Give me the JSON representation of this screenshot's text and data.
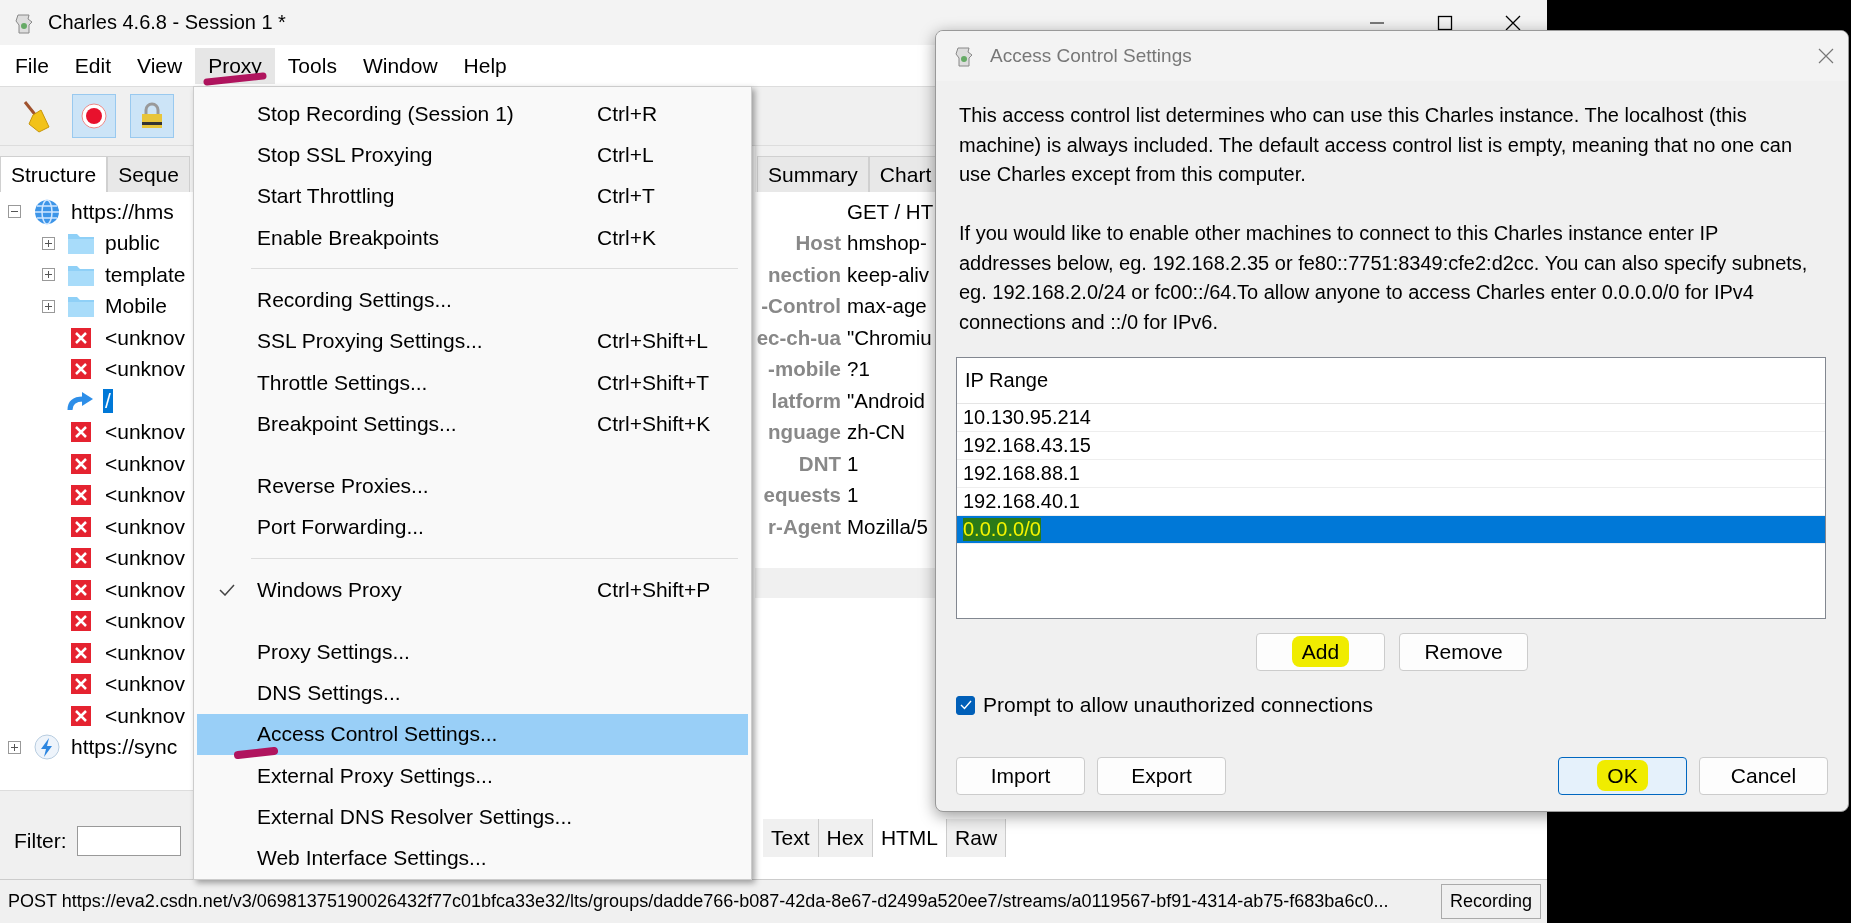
{
  "window": {
    "title": "Charles 4.6.8 - Session 1 *"
  },
  "menu_bar": [
    {
      "label": "File",
      "selected": false,
      "marked": false
    },
    {
      "label": "Edit",
      "selected": false,
      "marked": false
    },
    {
      "label": "View",
      "selected": false,
      "marked": false
    },
    {
      "label": "Proxy",
      "selected": true,
      "marked": true
    },
    {
      "label": "Tools",
      "selected": false,
      "marked": false
    },
    {
      "label": "Window",
      "selected": false,
      "marked": false
    },
    {
      "label": "Help",
      "selected": false,
      "marked": false
    }
  ],
  "left_tabs": [
    {
      "label": "Structure",
      "selected": true
    },
    {
      "label": "Seque",
      "selected": false
    }
  ],
  "tree": [
    {
      "label": "https://hms",
      "kind": "host",
      "expanded": true,
      "selected": false,
      "children": [
        {
          "label": "public",
          "kind": "folder",
          "expanded": false,
          "selected": false
        },
        {
          "label": "template",
          "kind": "folder",
          "expanded": false,
          "selected": false
        },
        {
          "label": "Mobile",
          "kind": "folder",
          "expanded": false,
          "selected": false
        },
        {
          "label": "<unknov",
          "kind": "error",
          "selected": false
        },
        {
          "label": "<unknov",
          "kind": "error",
          "selected": false
        },
        {
          "label": "/",
          "kind": "redirect",
          "selected": true
        },
        {
          "label": "<unknov",
          "kind": "error",
          "selected": false
        },
        {
          "label": "<unknov",
          "kind": "error",
          "selected": false
        },
        {
          "label": "<unknov",
          "kind": "error",
          "selected": false
        },
        {
          "label": "<unknov",
          "kind": "error",
          "selected": false
        },
        {
          "label": "<unknov",
          "kind": "error",
          "selected": false
        },
        {
          "label": "<unknov",
          "kind": "error",
          "selected": false
        },
        {
          "label": "<unknov",
          "kind": "error",
          "selected": false
        },
        {
          "label": "<unknov",
          "kind": "error",
          "selected": false
        },
        {
          "label": "<unknov",
          "kind": "error",
          "selected": false
        },
        {
          "label": "<unknov",
          "kind": "error",
          "selected": false
        }
      ]
    },
    {
      "label": "https://sync",
      "kind": "host-bolt",
      "expanded": false,
      "selected": false
    }
  ],
  "filter": {
    "label": "Filter:"
  },
  "detail_tabs": [
    {
      "label": "Summary",
      "selected": false
    },
    {
      "label": "Chart",
      "selected": false
    }
  ],
  "request_headers": {
    "request_line": "GET / HT",
    "rows": [
      {
        "name": "Host",
        "value": "hmshop-"
      },
      {
        "name": "nection",
        "value": "keep-aliv"
      },
      {
        "name": "-Control",
        "value": "max-age"
      },
      {
        "name": "ec-ch-ua",
        "value": "\"Chromiu"
      },
      {
        "name": "-mobile",
        "value": "?1"
      },
      {
        "name": "latform",
        "value": "\"Android"
      },
      {
        "name": "nguage",
        "value": "zh-CN"
      },
      {
        "name": "DNT",
        "value": "1"
      },
      {
        "name": "equests",
        "value": "1"
      },
      {
        "name": "r-Agent",
        "value": "Mozilla/5"
      }
    ]
  },
  "body_tabs": [
    {
      "label": "Text",
      "selected": false
    },
    {
      "label": "Hex",
      "selected": false
    },
    {
      "label": "HTML",
      "selected": true
    },
    {
      "label": "Raw",
      "selected": false
    }
  ],
  "status_bar": {
    "text": "POST https://eva2.csdn.net/v3/06981375190026432f77c01bfca33e32/lts/groups/dadde766-b087-42da-8e67-d2499a520ee7/streams/a0119567-bf91-4314-ab75-f683ba6c0...",
    "button": "Recording"
  },
  "proxy_menu": {
    "items": [
      {
        "kind": "item",
        "label": "Stop Recording (Session 1)",
        "shortcut": "Ctrl+R",
        "checked": false,
        "selected": false,
        "marked": false
      },
      {
        "kind": "item",
        "label": "Stop SSL Proxying",
        "shortcut": "Ctrl+L",
        "checked": false,
        "selected": false,
        "marked": false
      },
      {
        "kind": "item",
        "label": "Start Throttling",
        "shortcut": "Ctrl+T",
        "checked": false,
        "selected": false,
        "marked": false
      },
      {
        "kind": "item",
        "label": "Enable Breakpoints",
        "shortcut": "Ctrl+K",
        "checked": false,
        "selected": false,
        "marked": false
      },
      {
        "kind": "separator"
      },
      {
        "kind": "item",
        "label": "Recording Settings...",
        "checked": false,
        "selected": false,
        "marked": false
      },
      {
        "kind": "item",
        "label": "SSL Proxying Settings...",
        "shortcut": "Ctrl+Shift+L",
        "checked": false,
        "selected": false,
        "marked": false
      },
      {
        "kind": "item",
        "label": "Throttle Settings...",
        "shortcut": "Ctrl+Shift+T",
        "checked": false,
        "selected": false,
        "marked": false
      },
      {
        "kind": "item",
        "label": "Breakpoint Settings...",
        "shortcut": "Ctrl+Shift+K",
        "checked": false,
        "selected": false,
        "marked": false
      },
      {
        "kind": "spacer"
      },
      {
        "kind": "item",
        "label": "Reverse Proxies...",
        "checked": false,
        "selected": false,
        "marked": false
      },
      {
        "kind": "item",
        "label": "Port Forwarding...",
        "checked": false,
        "selected": false,
        "marked": false
      },
      {
        "kind": "separator"
      },
      {
        "kind": "item",
        "label": "Windows Proxy",
        "shortcut": "Ctrl+Shift+P",
        "checked": true,
        "selected": false,
        "marked": false
      },
      {
        "kind": "spacer"
      },
      {
        "kind": "item",
        "label": "Proxy Settings...",
        "checked": false,
        "selected": false,
        "marked": false
      },
      {
        "kind": "item",
        "label": "DNS Settings...",
        "checked": false,
        "selected": false,
        "marked": false
      },
      {
        "kind": "item",
        "label": "Access Control Settings...",
        "checked": false,
        "selected": true,
        "marked": true
      },
      {
        "kind": "item",
        "label": "External Proxy Settings...",
        "checked": false,
        "selected": false,
        "marked": false
      },
      {
        "kind": "item",
        "label": "External DNS Resolver Settings...",
        "checked": false,
        "selected": false,
        "marked": false
      },
      {
        "kind": "item",
        "label": "Web Interface Settings...",
        "checked": false,
        "selected": false,
        "marked": false
      }
    ]
  },
  "dialog": {
    "title": "Access Control Settings",
    "paragraphs": [
      "This access control list determines who can use this Charles instance. The localhost (this machine) is always included. The default access control list is empty, meaning that no one can use Charles except from this computer.",
      "If you would like to enable other machines to connect to this Charles instance enter IP addresses below, eg. 192.168.2.35 or fe80::7751:8349:cfe2:d2cc. You can also specify subnets, eg. 192.168.2.0/24 or fc00::/64.To allow anyone to access Charles enter 0.0.0.0/0 for IPv4 connections and ::/0 for IPv6."
    ],
    "table": {
      "column": "IP Range",
      "rows": [
        {
          "value": "10.130.95.214",
          "selected": false,
          "highlighted": false
        },
        {
          "value": "192.168.43.15",
          "selected": false,
          "highlighted": false
        },
        {
          "value": "192.168.88.1",
          "selected": false,
          "highlighted": false
        },
        {
          "value": "192.168.40.1",
          "selected": false,
          "highlighted": false
        },
        {
          "value": "0.0.0.0/0",
          "selected": true,
          "highlighted": true
        }
      ]
    },
    "list_buttons": [
      {
        "label": "Add",
        "highlighted": true
      },
      {
        "label": "Remove",
        "highlighted": false
      }
    ],
    "checkbox": {
      "label": "Prompt to allow unauthorized connections",
      "checked": true
    },
    "footer_left": [
      {
        "label": "Import",
        "default": false,
        "highlighted": false
      },
      {
        "label": "Export",
        "default": false,
        "highlighted": false
      }
    ],
    "footer_right": [
      {
        "label": "OK",
        "default": true,
        "highlighted": true
      },
      {
        "label": "Cancel",
        "default": false,
        "highlighted": false
      }
    ]
  }
}
